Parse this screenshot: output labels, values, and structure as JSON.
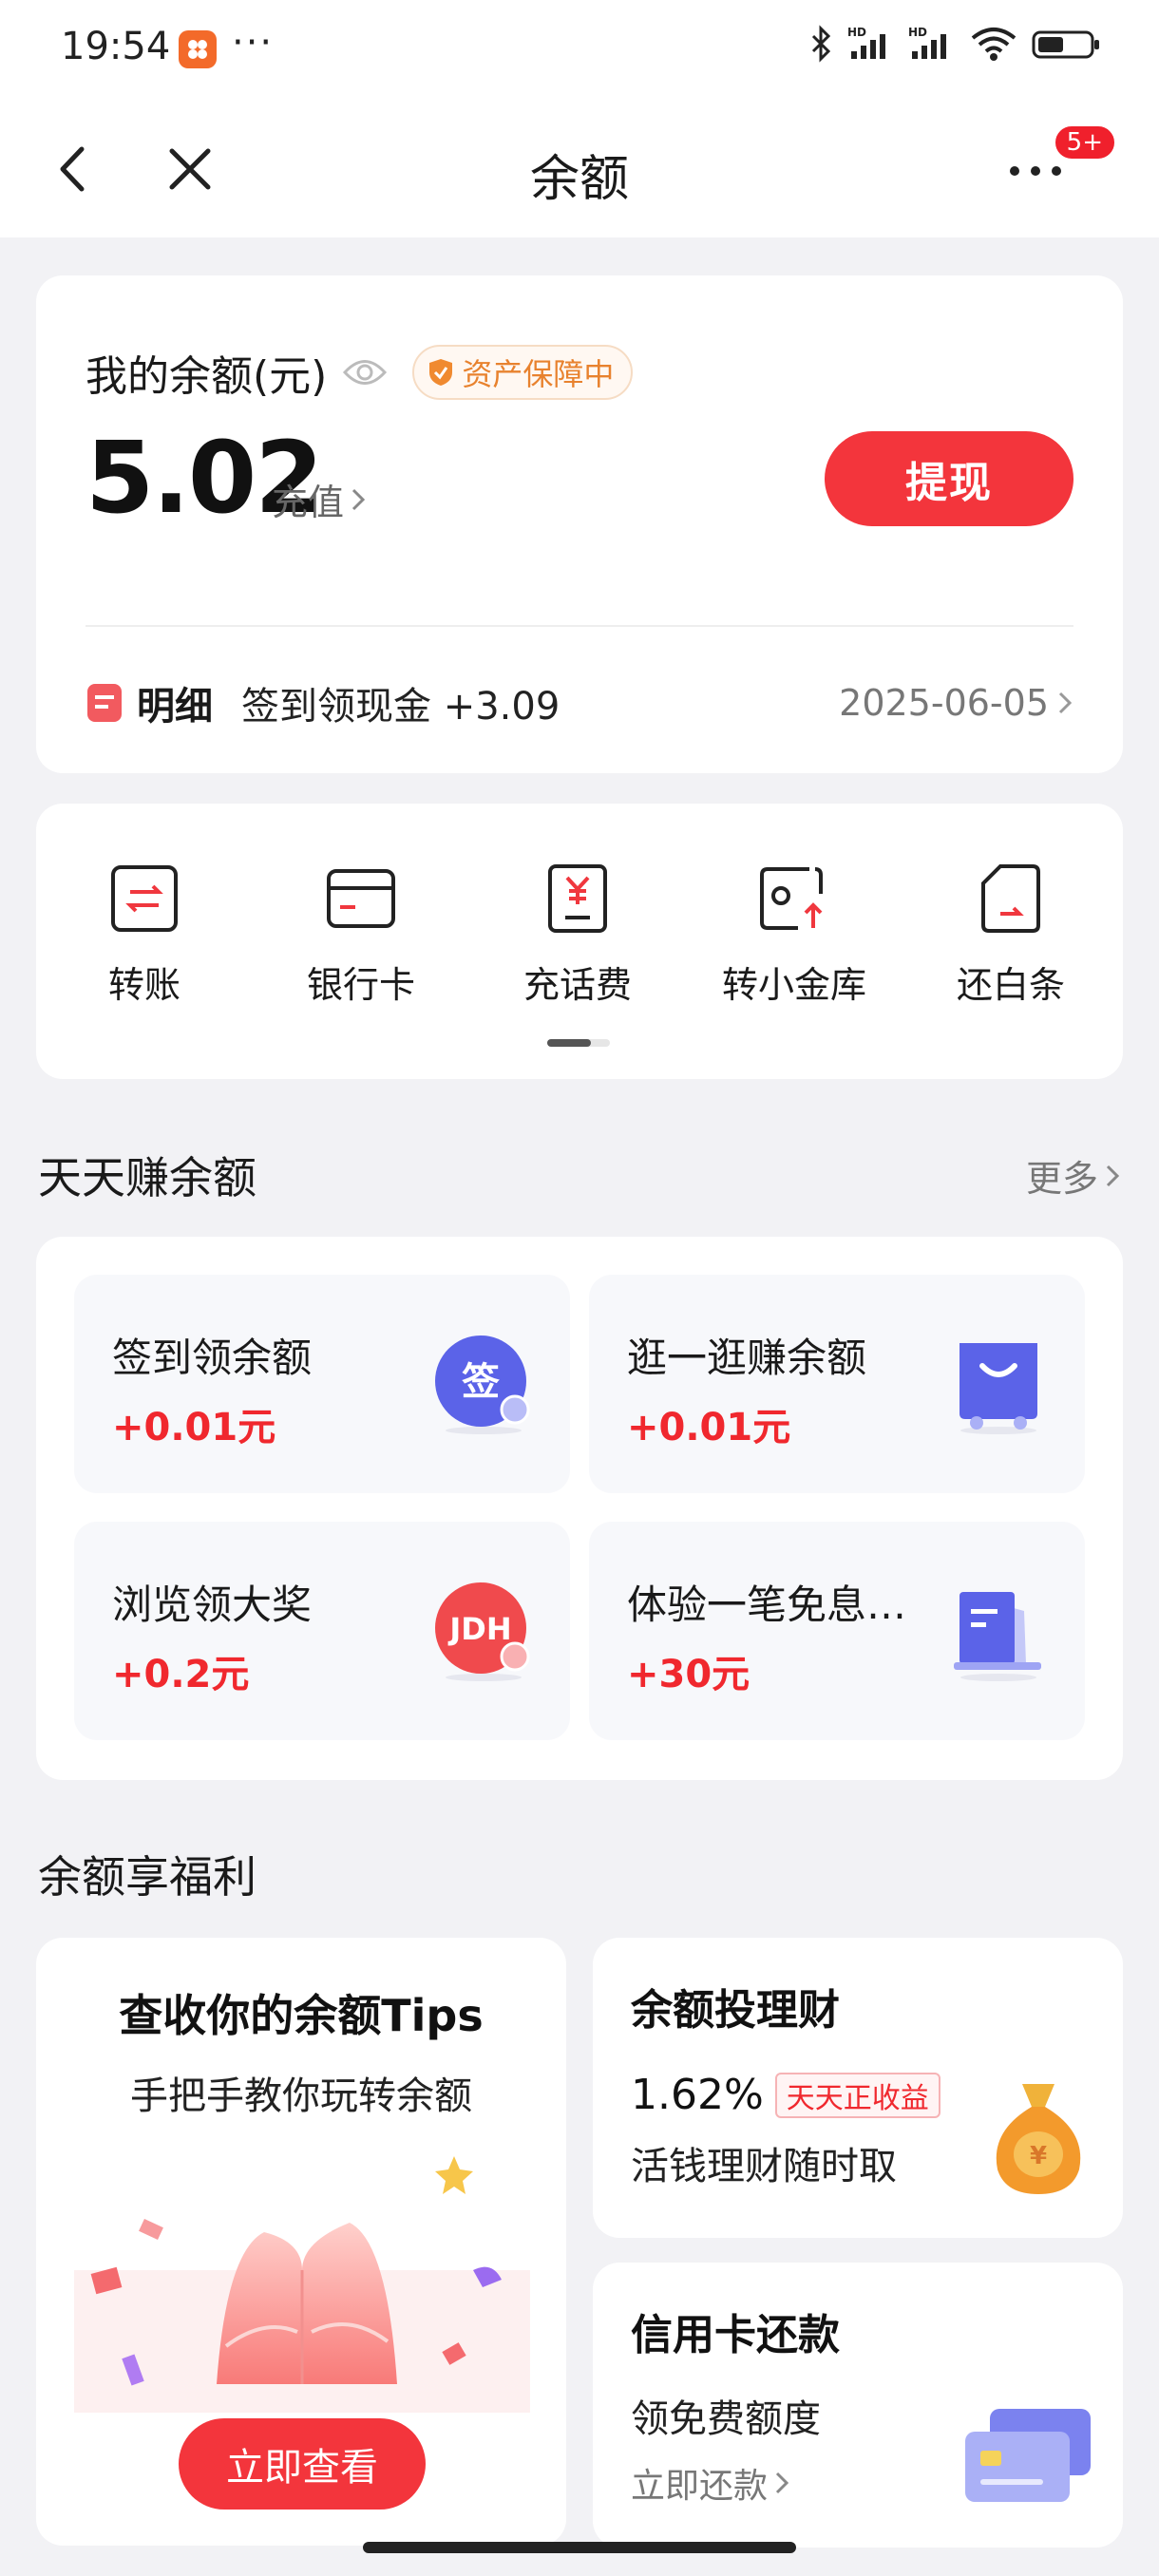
{
  "status_bar": {
    "time": "19:54",
    "more": "···",
    "icons": [
      "bluetooth-icon",
      "signal-hd-icon",
      "signal-hd-icon",
      "wifi-icon",
      "battery-icon"
    ]
  },
  "nav": {
    "title": "余额",
    "badge": "5+"
  },
  "balance": {
    "label": "我的余额(元)",
    "guard": "资产保障中",
    "amount": "5.02",
    "recharge": "充值",
    "withdraw": "提现",
    "detail_title": "明细",
    "detail_text": "签到领现金 +3.09",
    "detail_date": "2025-06-05"
  },
  "actions": [
    {
      "label": "转账",
      "icon": "transfer-icon"
    },
    {
      "label": "银行卡",
      "icon": "bank-card-icon"
    },
    {
      "label": "充话费",
      "icon": "phone-recharge-icon"
    },
    {
      "label": "转小金库",
      "icon": "vault-transfer-icon"
    },
    {
      "label": "还白条",
      "icon": "repay-icon"
    }
  ],
  "earn": {
    "title": "天天赚余额",
    "more": "更多",
    "items": [
      {
        "name": "签到领余额",
        "reward": "+0.01元",
        "icon_text": "签"
      },
      {
        "name": "逛一逛赚余额",
        "reward": "+0.01元"
      },
      {
        "name": "浏览领大奖",
        "reward": "+0.2元",
        "icon_text": "JDH"
      },
      {
        "name": "体验一笔免息…",
        "reward": "+30元"
      }
    ]
  },
  "benefits": {
    "title": "余额享福利",
    "tips": {
      "title": "查收你的余额Tips",
      "subtitle": "手把手教你玩转余额",
      "button": "立即查看"
    },
    "finance": {
      "title": "余额投理财",
      "rate": "1.62%",
      "tag": "天天正收益",
      "subtitle": "活钱理财随时取"
    },
    "credit": {
      "title": "信用卡还款",
      "subtitle": "领免费额度",
      "link": "立即还款"
    }
  },
  "colors": {
    "accent": "#f3353c",
    "background": "#f2f2f5",
    "guard": "#e8822e"
  }
}
